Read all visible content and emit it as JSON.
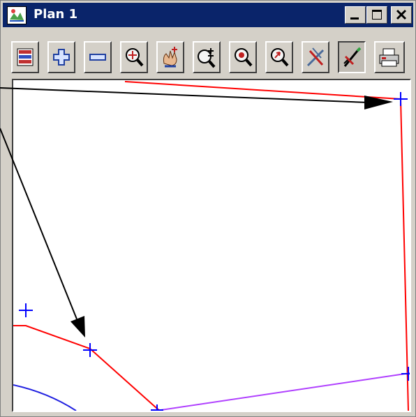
{
  "window": {
    "title": "Plan 1"
  },
  "title_controls": [
    {
      "name": "minimize-button",
      "icon": "minimize-icon"
    },
    {
      "name": "maximize-button",
      "icon": "maximize-icon"
    },
    {
      "name": "close-button",
      "icon": "close-icon"
    }
  ],
  "toolbar": [
    {
      "name": "plan-windows-button",
      "icon": "window-list-icon"
    },
    {
      "name": "add-button",
      "icon": "plus-icon"
    },
    {
      "name": "remove-button",
      "icon": "minus-icon"
    },
    {
      "name": "zoom-extent-button",
      "icon": "zoom-extent-icon"
    },
    {
      "name": "pan-button",
      "icon": "pan-hand-icon"
    },
    {
      "name": "zoom-in-out-button",
      "icon": "zoom-plus-minus-icon"
    },
    {
      "name": "zoom-centre-button",
      "icon": "zoom-centre-icon"
    },
    {
      "name": "zoom-previous-button",
      "icon": "zoom-previous-icon"
    },
    {
      "name": "toggle-cursor-button",
      "icon": "cross-cursor-icon"
    },
    {
      "name": "pick-button",
      "icon": "pick-pencil-icon",
      "pressed": true
    },
    {
      "name": "print-button",
      "icon": "printer-icon"
    }
  ],
  "colors": {
    "title_bar": "#0a246a",
    "window_bg": "#d4d0c8",
    "red_string": "#ff0000",
    "blue_string": "#2020e0",
    "purple_string": "#b040ff",
    "vertex_marker": "#0000ff",
    "arrow": "#000000"
  }
}
